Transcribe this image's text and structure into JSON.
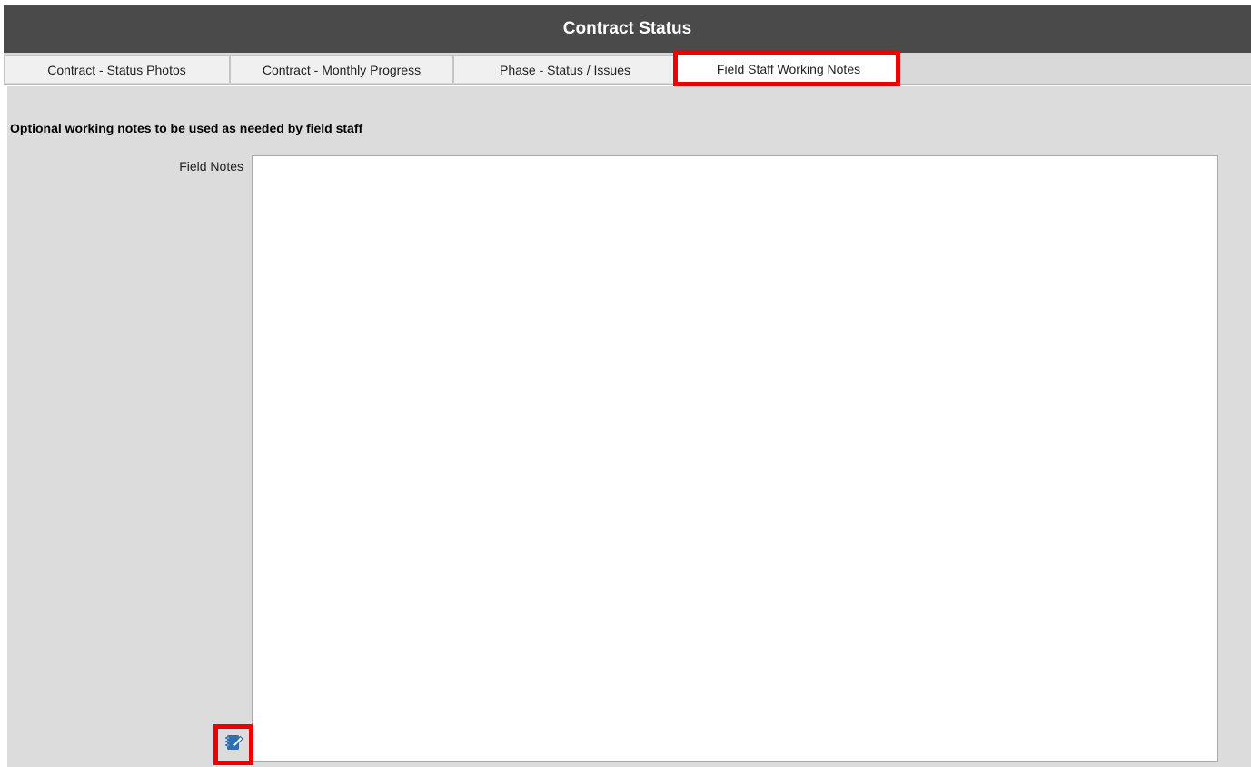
{
  "window": {
    "title": "Contract Status"
  },
  "tabs": [
    {
      "label": "Contract - Status Photos",
      "active": false
    },
    {
      "label": "Contract - Monthly Progress",
      "active": false
    },
    {
      "label": "Phase - Status / Issues",
      "active": false
    },
    {
      "label": "Field Staff Working Notes",
      "active": true
    }
  ],
  "main": {
    "heading": "Optional working notes to be used as needed by field staff",
    "field_notes": {
      "label": "Field Notes",
      "value": "",
      "placeholder": ""
    },
    "edit_button": {
      "icon": "notepad-edit-icon"
    }
  },
  "colors": {
    "titlebar": "#4a4a4a",
    "highlight": "#ee0000",
    "panel": "#dcdcdc",
    "icon": "#2f6fb0"
  }
}
